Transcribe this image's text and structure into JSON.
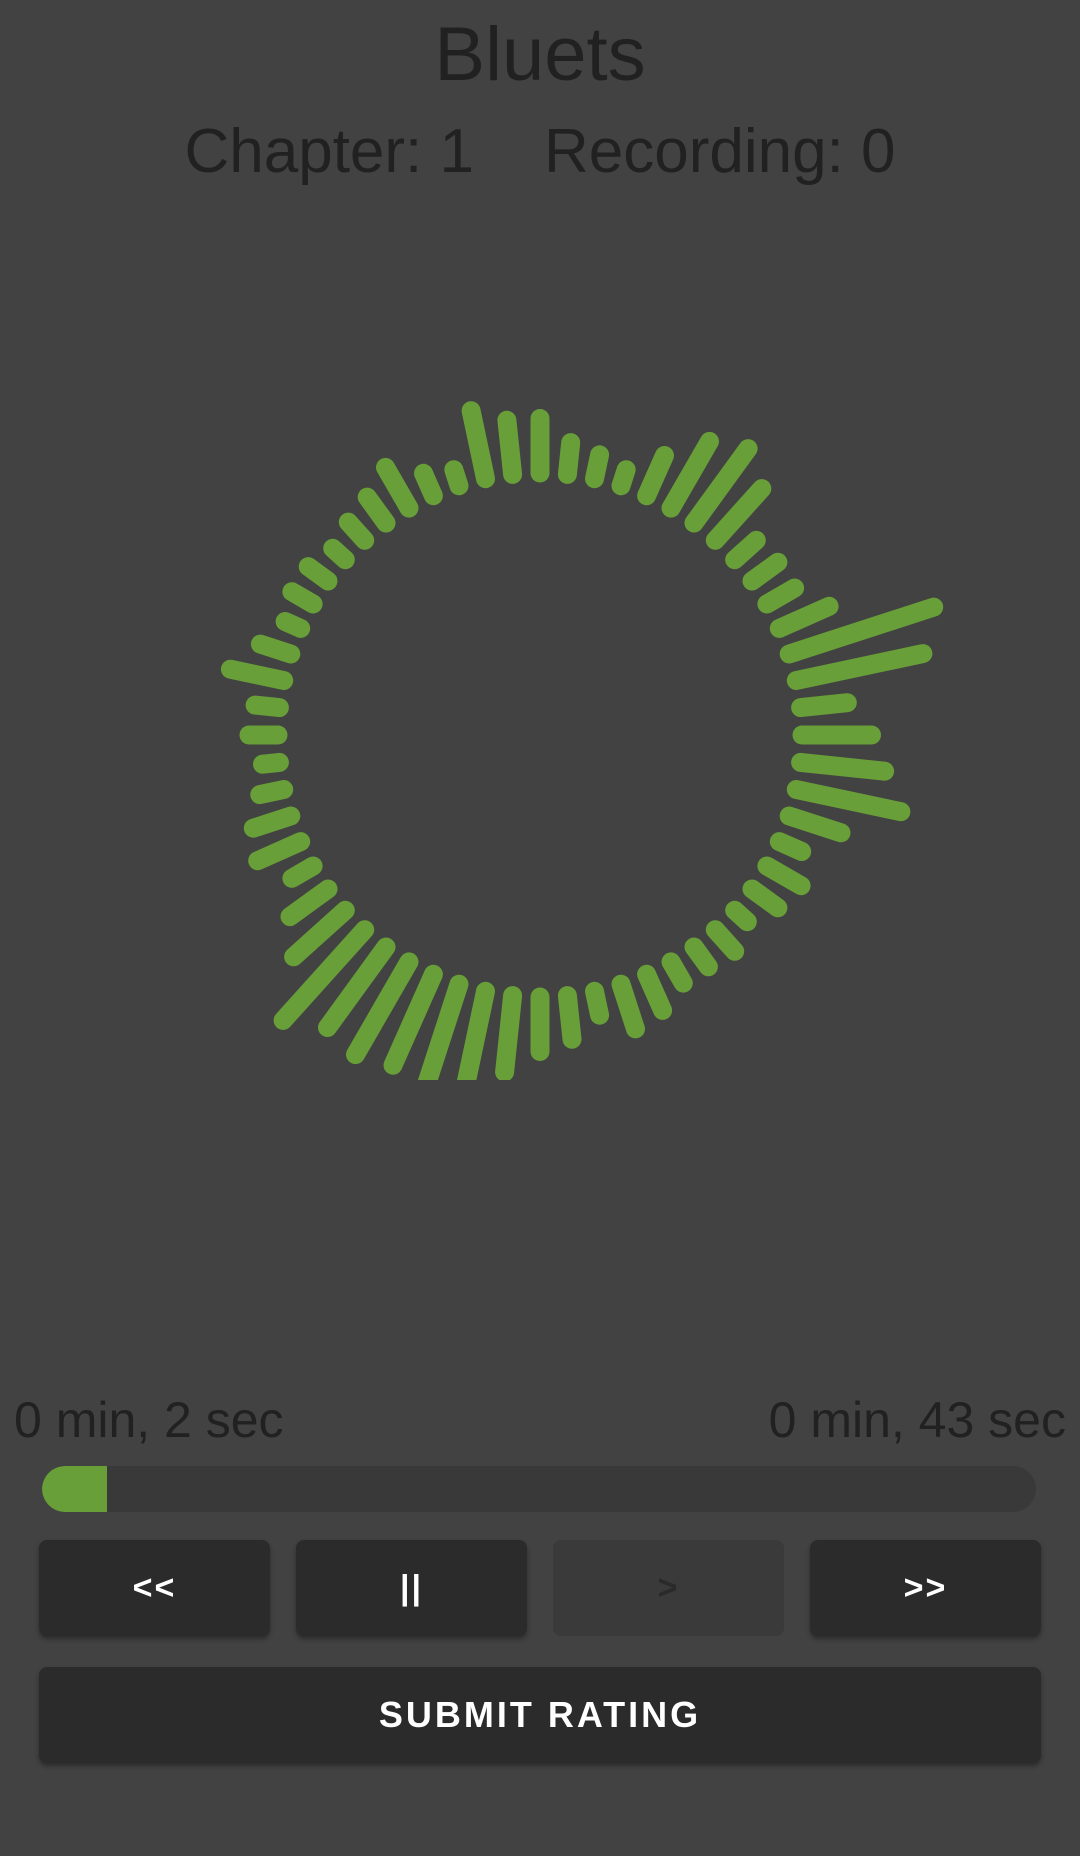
{
  "header": {
    "title": "Bluets",
    "chapter": "Chapter: 1",
    "recording": "Recording: 0"
  },
  "visualizer": {
    "color": "#689f38",
    "bar_levels": [
      0.35,
      0.2,
      0.15,
      0.1,
      0.28,
      0.5,
      0.6,
      0.45,
      0.18,
      0.2,
      0.2,
      0.35,
      1.0,
      0.85,
      0.3,
      0.45,
      0.55,
      0.7,
      0.35,
      0.15,
      0.25,
      0.2,
      0.1,
      0.18,
      0.15,
      0.15,
      0.25,
      0.3,
      0.15,
      0.28,
      0.35,
      0.5,
      0.6,
      0.7,
      0.65,
      0.7,
      0.65,
      0.8,
      0.45,
      0.3,
      0.15,
      0.3,
      0.25,
      0.15,
      0.1,
      0.18,
      0.15,
      0.35,
      0.2,
      0.1,
      0.15,
      0.15,
      0.1,
      0.15,
      0.2,
      0.3,
      0.15,
      0.1,
      0.45,
      0.35
    ]
  },
  "player": {
    "elapsed": "0 min, 2 sec",
    "total": "0 min, 43 sec",
    "progress_fraction": 0.065,
    "accent_color": "#689f38"
  },
  "controls": {
    "rewind_label": "<<",
    "pause_label": "||",
    "play_label": ">",
    "forward_label": ">>",
    "submit_label": "SUBMIT RATING"
  }
}
